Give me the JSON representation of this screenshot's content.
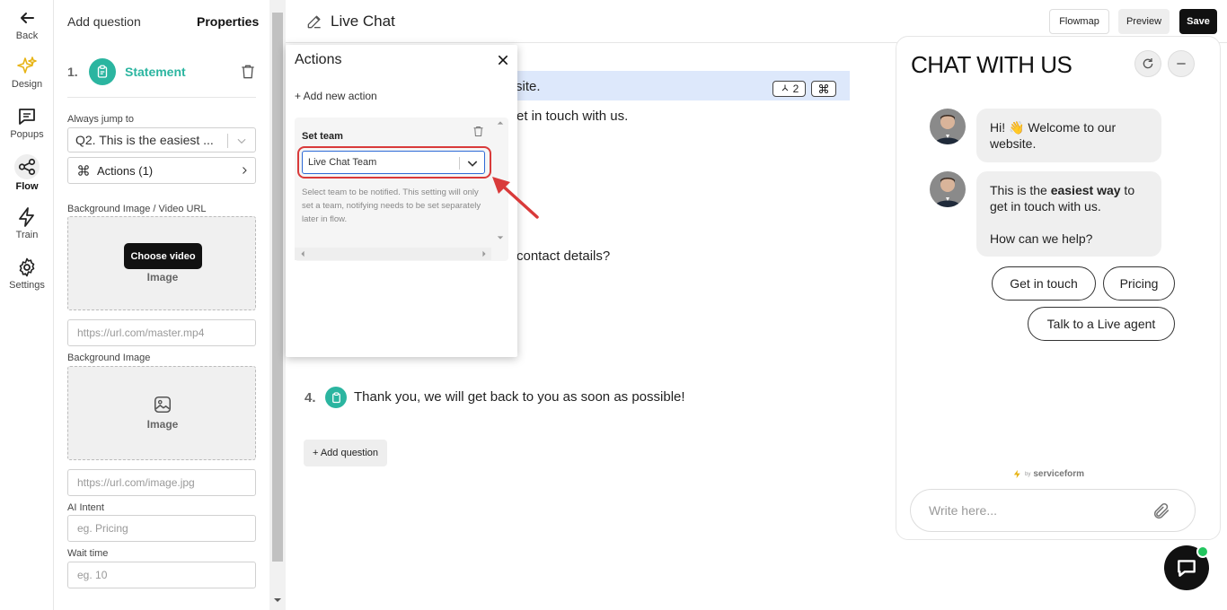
{
  "rail": {
    "back": "Back",
    "items": [
      {
        "label": "Design"
      },
      {
        "label": "Popups"
      },
      {
        "label": "Flow"
      },
      {
        "label": "Train"
      },
      {
        "label": "Settings"
      }
    ]
  },
  "props": {
    "tab_add": "Add question",
    "tab_properties": "Properties",
    "q_number": "1.",
    "q_type": "Statement",
    "always_jump_label": "Always jump to",
    "always_jump_value": "Q2. This is the easiest ...",
    "actions_button": "Actions (1)",
    "bg_media_label": "Background Image / Video URL",
    "choose_video": "Choose video",
    "image_text": "Image",
    "video_url_placeholder": "https://url.com/master.mp4",
    "bg_image_label": "Background Image",
    "image_text2": "Image",
    "image_url_placeholder": "https://url.com/image.jpg",
    "ai_intent_label": "AI Intent",
    "ai_intent_placeholder": "eg. Pricing",
    "wait_time_label": "Wait time",
    "wait_time_placeholder": "eg. 10"
  },
  "header": {
    "title": "Live Chat",
    "flowmap": "Flowmap",
    "preview": "Preview",
    "save": "Save"
  },
  "canvas": {
    "q1_text_partial": "site.",
    "q1_badge_count": "2",
    "q2_text_partial": "et in touch with us.",
    "q3_text_partial": "contact details?",
    "q4_number": "4.",
    "q4_text": "Thank you, we will get back to you as soon as possible!",
    "add_question": "+ Add question"
  },
  "actions_popup": {
    "title": "Actions",
    "add_new": "+ Add new action",
    "card_title": "Set team",
    "team_value": "Live Chat Team",
    "help_text": "Select team to be notified. This setting will only set a team, notifying needs to be set separately later in flow."
  },
  "chat": {
    "title": "CHAT WITH US",
    "bubble1": "Hi! 👋 Welcome to our website.",
    "bubble2_pre": "This is the ",
    "bubble2_bold": "easiest way",
    "bubble2_post": " to get in touch with us.",
    "bubble2_line2": "How can we help?",
    "chips": [
      "Get in touch",
      "Pricing",
      "Talk to a Live agent"
    ],
    "powered_by": "by",
    "brand": "serviceform",
    "input_placeholder": "Write here..."
  },
  "colors": {
    "accent": "#2bb5a0",
    "highlight_row": "#dde8fb",
    "annotation_red": "#d93a3a",
    "online_dot": "#22c55e"
  }
}
